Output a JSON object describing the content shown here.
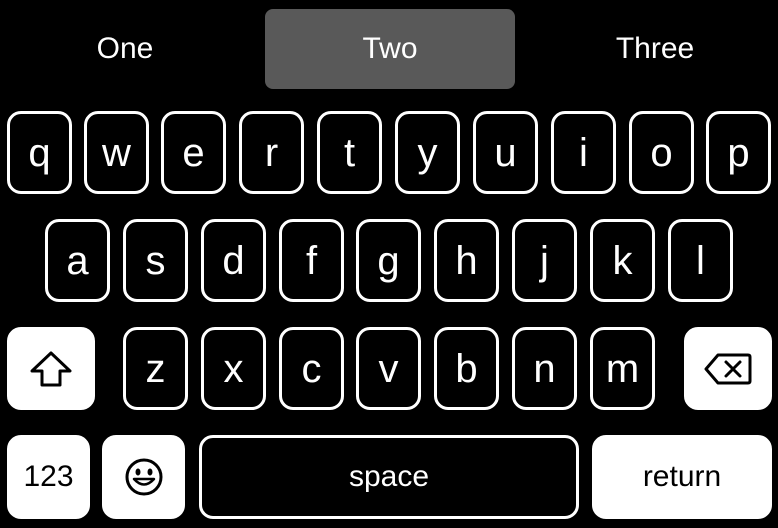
{
  "suggestions": [
    "One",
    "Two",
    "Three"
  ],
  "selected_suggestion": "Two",
  "rows": {
    "row1": [
      "q",
      "w",
      "e",
      "r",
      "t",
      "y",
      "u",
      "i",
      "o",
      "p"
    ],
    "row2": [
      "a",
      "s",
      "d",
      "f",
      "g",
      "h",
      "j",
      "k",
      "l"
    ],
    "row3": [
      "z",
      "x",
      "c",
      "v",
      "b",
      "n",
      "m"
    ]
  },
  "keys": {
    "shift_icon": "shift-icon",
    "delete_icon": "delete-icon",
    "numbers_label": "123",
    "emoji_icon": "emoji-icon",
    "space_label": "space",
    "return_label": "return"
  }
}
